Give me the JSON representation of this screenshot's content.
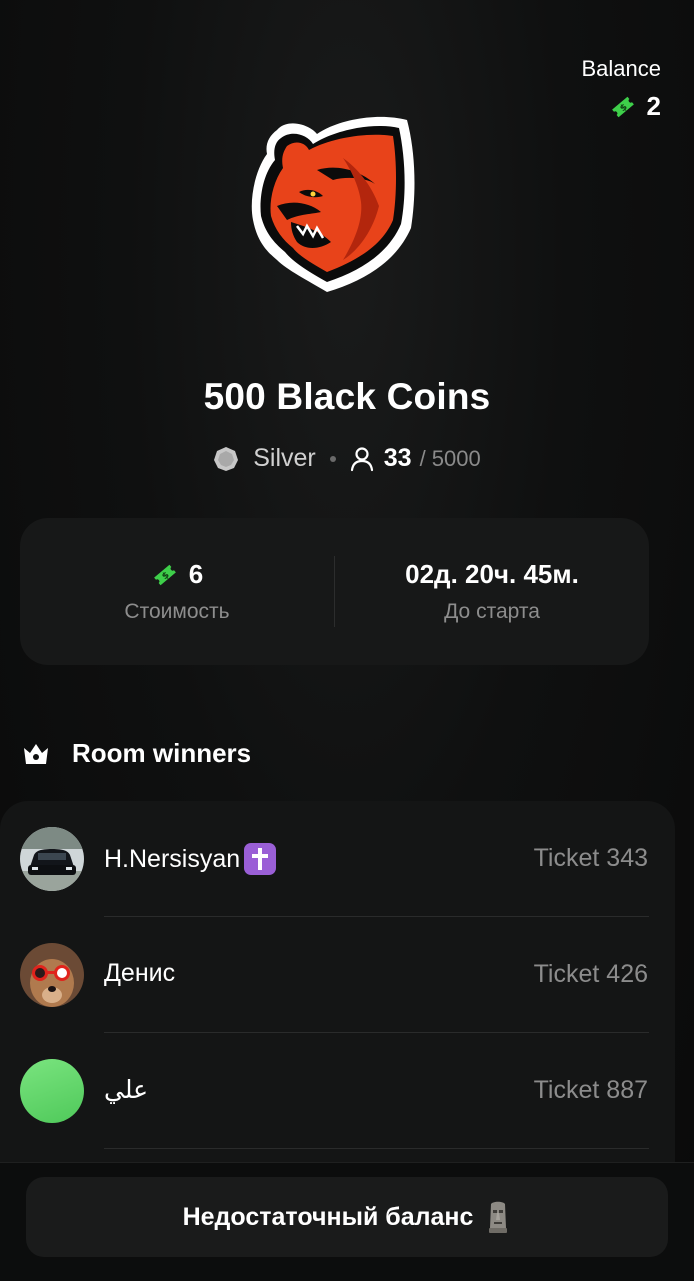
{
  "balance": {
    "label": "Balance",
    "value": "2",
    "icon": "ticket-icon",
    "icon_color": "#3ecf4a"
  },
  "room": {
    "logo": "bear-logo",
    "title": "500 Black Coins",
    "tier": "Silver",
    "participants": "33",
    "participants_max": "/ 5000"
  },
  "info": {
    "cost_value": "6",
    "cost_label": "Стоимость",
    "start_value": "02д. 20ч. 45м.",
    "start_label": "До старта"
  },
  "winners": {
    "title": "Room winners",
    "items": [
      {
        "name": "H.Nersisyan",
        "ticket": "Ticket 343",
        "avatar": "car-photo",
        "badge": "latin-cross-emoji"
      },
      {
        "name": "Денис",
        "ticket": "Ticket 426",
        "avatar": "dog-photo"
      },
      {
        "name": "علي",
        "ticket": "Ticket 887",
        "avatar": "green-circle",
        "avatar_color": "#5fd86a"
      }
    ]
  },
  "action": {
    "label": "Недостаточный баланс",
    "icon": "moai-icon"
  }
}
